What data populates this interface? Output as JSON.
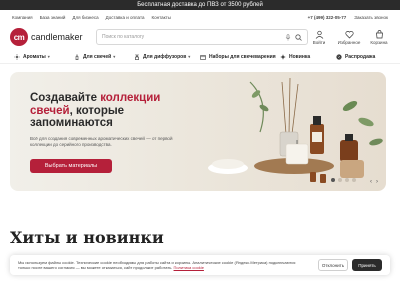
{
  "promo": {
    "text": "Бесплатная доставка до ПВЗ от 3500 рублей"
  },
  "topbar": {
    "links": [
      "Компания",
      "База знаний",
      "Для бизнеса",
      "Доставка и оплата",
      "Контакты"
    ],
    "phone": "+7 (499) 322-05-77",
    "callback": "Заказать звонок"
  },
  "header": {
    "logo_mark": "cm",
    "logo_text": "candlemaker",
    "search_placeholder": "Поиск по каталогу",
    "icons": [
      {
        "name": "user-icon",
        "label": "Войти"
      },
      {
        "name": "heart-icon",
        "label": "Избранное"
      },
      {
        "name": "cart-icon",
        "label": "Корзина"
      }
    ]
  },
  "categories": [
    {
      "label": "Ароматы",
      "icon": "aroma-icon"
    },
    {
      "label": "Для свечей",
      "icon": "candle-icon"
    },
    {
      "label": "Для диффузоров",
      "icon": "diffuser-icon"
    },
    {
      "label": "Наборы для свечеварения",
      "icon": "box-icon"
    },
    {
      "label": "Новинка",
      "icon": "sparkle-icon"
    },
    {
      "label": "Распродажа",
      "icon": "percent-icon"
    }
  ],
  "hero": {
    "title_line1": "Создавайте ",
    "title_accent": "коллекции свечей",
    "title_line2": ", которые запоминаются",
    "subtitle": "Всё для создания современных ароматических свечей — от первой коллекции до серийного производства.",
    "button": "Выбрать материалы",
    "slides": 4,
    "active_slide": 1,
    "accent_color": "#b5203a"
  },
  "section": {
    "title": "Хиты и новинки",
    "chevron": "›"
  },
  "cookie": {
    "text": "Мы используем файлы cookie. Технические cookie необходимы для работы сайта и корзины. Аналитические cookie (Яндекс.Метрика) подключаются только после вашего согласия — вы можете отказаться, сайт продолжит работать.",
    "link": "Политика cookie",
    "decline": "Отклонить",
    "accept": "Принять"
  }
}
